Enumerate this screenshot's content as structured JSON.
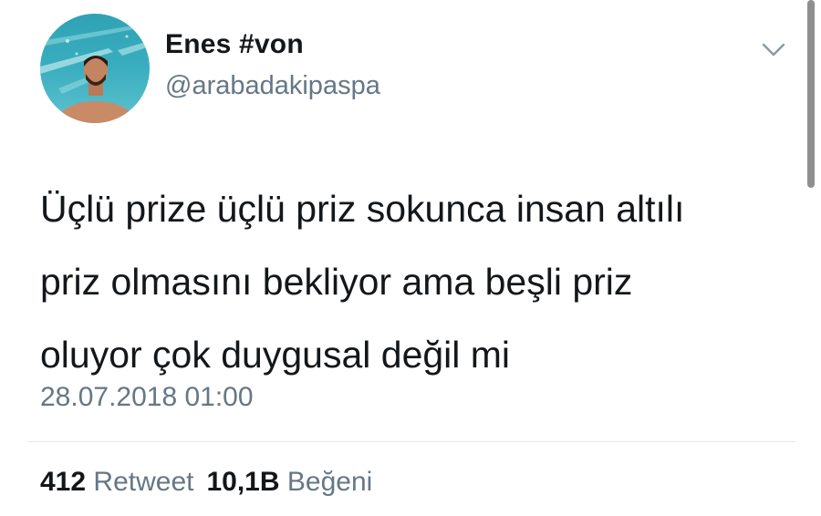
{
  "tweet": {
    "user": {
      "display_name": "Enes #von",
      "handle": "@arabadakipaspa"
    },
    "text": "Üçlü prize üçlü priz sokunca insan altılı\npriz olmasını bekliyor ama beşli priz\noluyor çok duygusal değil mi",
    "timestamp": "28.07.2018 01:00",
    "stats": {
      "retweets": {
        "count": "412",
        "label": "Retweet"
      },
      "likes": {
        "count": "10,1B",
        "label": "Beğeni"
      }
    }
  },
  "icons": {
    "menu": "chevron-down-icon"
  },
  "colors": {
    "text_primary": "#14171a",
    "text_secondary": "#657786",
    "divider": "#e1e8ed"
  }
}
